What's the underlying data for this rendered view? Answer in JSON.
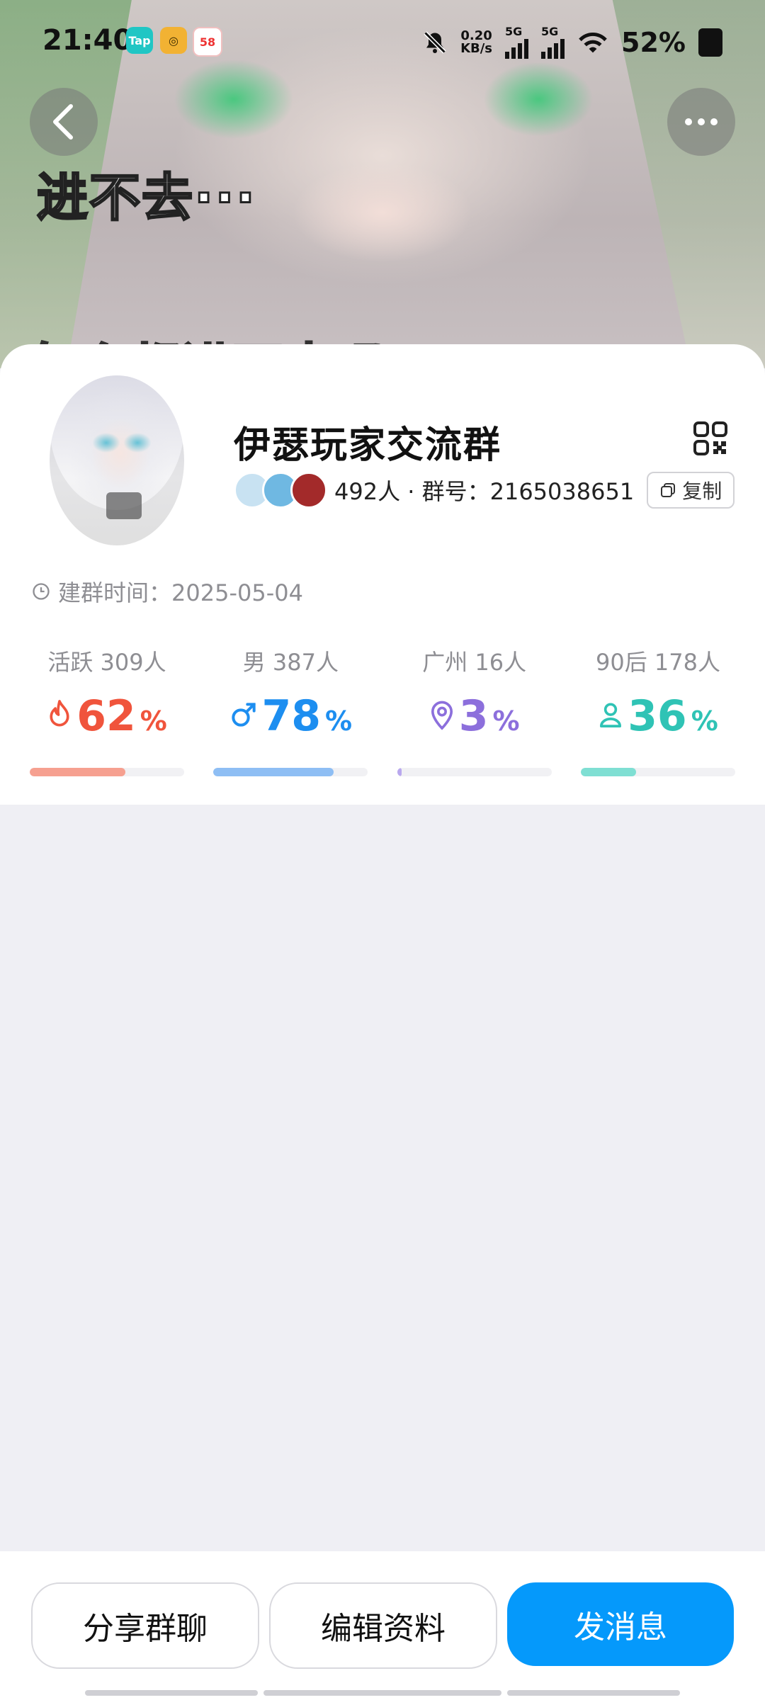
{
  "status_bar": {
    "time": "21:40",
    "app_icons": [
      "Tap",
      "◎",
      "58"
    ],
    "net_speed": [
      "0.20",
      "KB/s"
    ],
    "network": [
      "5G",
      "5G"
    ],
    "battery": "52%"
  },
  "banner": {
    "caption": "进不去···",
    "caption2": "怎么都进不去吗"
  },
  "group": {
    "name": "伊瑟玩家交流群",
    "members": "492人 · 群号：2165038651",
    "copy_label": "复制",
    "created": "建群时间：2025-05-04"
  },
  "stats": [
    {
      "label": "活跃 309人",
      "value": "62",
      "unit": "%",
      "color": "#f0543c",
      "bar_color": "#f6a090",
      "percent": 62,
      "icon": "flame-icon"
    },
    {
      "label": "男 387人",
      "value": "78",
      "unit": "%",
      "color": "#1d8ef0",
      "bar_color": "#8ebef4",
      "percent": 78,
      "icon": "male-icon"
    },
    {
      "label": "广州 16人",
      "value": "3",
      "unit": "%",
      "color": "#8c6fdc",
      "bar_color": "#b9a8ee",
      "percent": 3,
      "icon": "location-pin-icon"
    },
    {
      "label": "90后 178人",
      "value": "36",
      "unit": "%",
      "color": "#2fc3b5",
      "bar_color": "#7fdfd3",
      "percent": 36,
      "icon": "person-icon"
    }
  ],
  "actions": {
    "share": "分享群聊",
    "edit": "编辑资料",
    "message": "发消息"
  }
}
